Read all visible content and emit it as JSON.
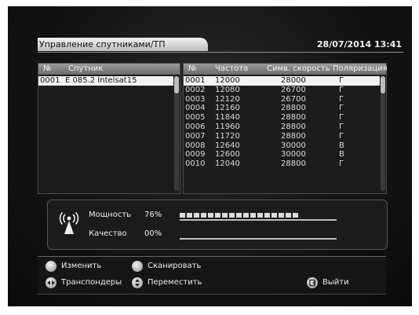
{
  "header": {
    "title": "Управление спутниками/ТП",
    "datetime": "28/07/2014 13:41"
  },
  "satellites": {
    "columns": {
      "num": "№",
      "name": "Спутник"
    },
    "rows": [
      {
        "num": "0001",
        "name": "E 085.2 Intelsat15"
      }
    ]
  },
  "transponders": {
    "columns": {
      "num": "№",
      "freq": "Частота",
      "symrate": "Симв. скорость",
      "polar": "Поляризация"
    },
    "rows": [
      {
        "num": "0001",
        "freq": "12000",
        "symrate": "28000",
        "polar": "Г"
      },
      {
        "num": "0002",
        "freq": "12080",
        "symrate": "26700",
        "polar": "Г"
      },
      {
        "num": "0003",
        "freq": "12120",
        "symrate": "26700",
        "polar": "Г"
      },
      {
        "num": "0004",
        "freq": "12160",
        "symrate": "28800",
        "polar": "Г"
      },
      {
        "num": "0005",
        "freq": "11840",
        "symrate": "28800",
        "polar": "Г"
      },
      {
        "num": "0006",
        "freq": "11960",
        "symrate": "28800",
        "polar": "Г"
      },
      {
        "num": "0007",
        "freq": "11720",
        "symrate": "28800",
        "polar": "Г"
      },
      {
        "num": "0008",
        "freq": "12640",
        "symrate": "30000",
        "polar": "В"
      },
      {
        "num": "0009",
        "freq": "12600",
        "symrate": "30000",
        "polar": "В"
      },
      {
        "num": "0010",
        "freq": "12040",
        "symrate": "28800",
        "polar": "Г"
      }
    ]
  },
  "signal": {
    "power_label": "Мощность",
    "power_value": "76%",
    "power_fraction": 0.76,
    "quality_label": "Качество",
    "quality_value": "00%",
    "quality_fraction": 0.0
  },
  "buttons": {
    "edit": "Изменить",
    "scan": "Сканировать",
    "transponders": "Транспондеры",
    "move": "Переместить",
    "exit": "Выйти"
  },
  "icons": {
    "antenna": "antenna-signal-icon",
    "edit": "red-button-icon",
    "scan": "green-button-icon",
    "transponders": "left-right-arrows-icon",
    "move": "up-down-arrows-icon",
    "exit": "exit-icon"
  }
}
